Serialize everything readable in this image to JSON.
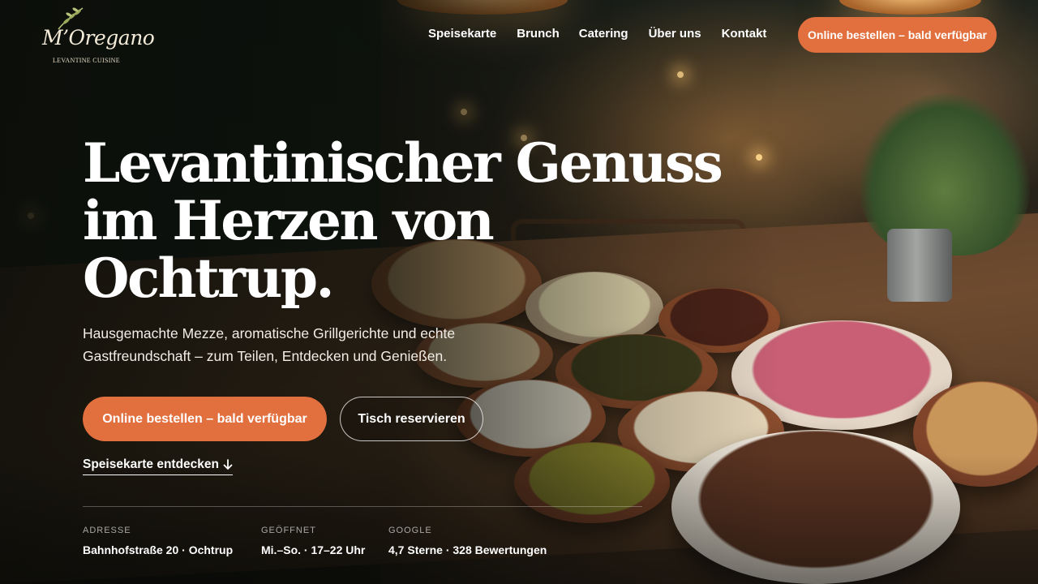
{
  "brand": {
    "name": "M’Oregano",
    "tagline": "LEVANTINE CUISINE"
  },
  "nav": {
    "items": [
      {
        "label": "Speisekarte"
      },
      {
        "label": "Brunch"
      },
      {
        "label": "Catering"
      },
      {
        "label": "Über uns"
      },
      {
        "label": "Kontakt"
      }
    ],
    "cta_label": "Online bestellen – bald verfügbar"
  },
  "hero": {
    "headline": [
      "Levantinischer Genuss",
      "im Herzen von",
      "Ochtrup."
    ],
    "subline": [
      "Hausgemachte Mezze, aromatische Grillgerichte und echte",
      "Gastfreundschaft – zum Teilen, Entdecken und Genießen."
    ],
    "primary_button": "Online bestellen – bald verfügbar",
    "secondary_button": "Tisch reservieren",
    "menu_link": "Speisekarte entdecken"
  },
  "info": [
    {
      "label": "ADRESSE",
      "value": "Bahnhofstraße 20 · Ochtrup"
    },
    {
      "label": "GEÖFFNET",
      "value": "Mi.–So. · 17–22 Uhr"
    },
    {
      "label": "GOOGLE",
      "value": "4,7 Sterne · 328 Bewertungen"
    }
  ],
  "colors": {
    "accent": "#e2703f",
    "text": "#ffffff"
  },
  "icons": {
    "menu_link_icon": "arrow-down-icon",
    "logo_icon": "olive-branch-icon"
  }
}
